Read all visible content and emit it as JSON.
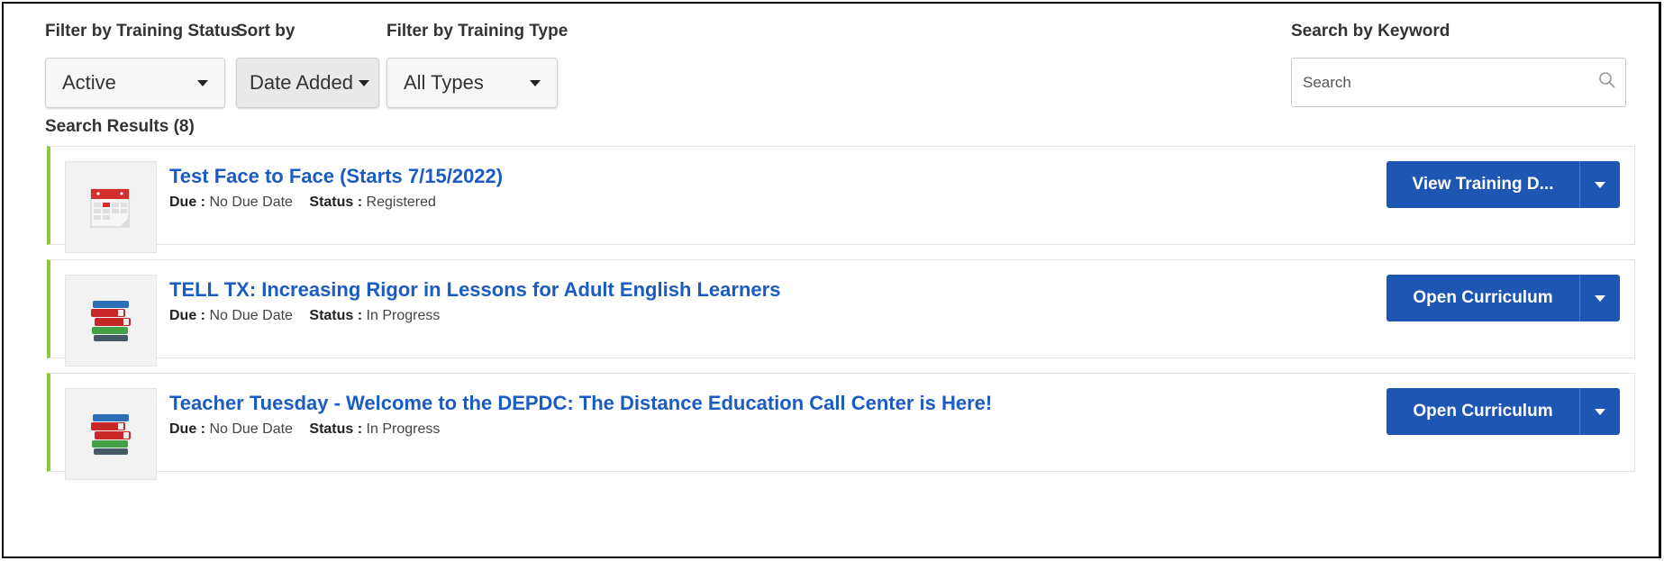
{
  "filters": {
    "status_label": "Filter by Training Status",
    "status_value": "Active",
    "sort_label": "Sort by",
    "sort_value": "Date Added",
    "type_label": "Filter by Training Type",
    "type_value": "All Types",
    "keyword_label": "Search by Keyword",
    "keyword_placeholder": "Search"
  },
  "results": {
    "heading": "Search Results (8)",
    "due_label": "Due :",
    "status_label": "Status :",
    "items": [
      {
        "title": "Test Face to Face (Starts 7/15/2022)",
        "due": "No Due Date",
        "status": "Registered",
        "action": "View Training D...",
        "icon": "calendar-icon"
      },
      {
        "title": "TELL TX: Increasing Rigor in Lessons for Adult English Learners",
        "due": "No Due Date",
        "status": "In Progress",
        "action": "Open Curriculum",
        "icon": "books-icon"
      },
      {
        "title": "Teacher Tuesday - Welcome to the DEPDC: The Distance Education Call Center is Here!",
        "due": "No Due Date",
        "status": "In Progress",
        "action": "Open Curriculum",
        "icon": "books-icon"
      }
    ]
  },
  "colors": {
    "accent": "#1e56b4",
    "link": "#1a5bc4",
    "card_border_left": "#8dc63f"
  }
}
